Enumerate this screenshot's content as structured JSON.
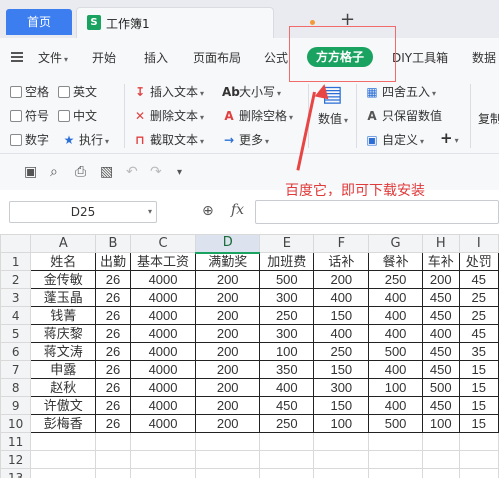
{
  "tabs": {
    "home": "首页",
    "doc_icon_letter": "S",
    "doc_title": "工作簿1",
    "doc_dot": "•",
    "new_tab": "+"
  },
  "menu": {
    "items": [
      "文件",
      "开始",
      "插入",
      "页面布局",
      "公式",
      "方方格子",
      "DIY工具箱",
      "数据"
    ],
    "file_caret": "▾",
    "active": "方方格子"
  },
  "ribbon": {
    "group1": [
      "空格",
      "英文",
      "符号",
      "中文",
      "数字"
    ],
    "execute": "执行",
    "group2": [
      "插入文本",
      "删除文本",
      "截取文本"
    ],
    "group3": [
      "大小写",
      "删除空格",
      "更多"
    ],
    "numeric": "数值",
    "group4": [
      "四舍五入",
      "只保留数值",
      "自定义"
    ],
    "plus": "+",
    "copy": "复制"
  },
  "annotation_text": "百度它，即可下载安装",
  "formula_bar": {
    "cell_ref": "D25",
    "fx": "fx",
    "value": ""
  },
  "sheet": {
    "columns": [
      "A",
      "B",
      "C",
      "D",
      "E",
      "F",
      "G",
      "H",
      "I"
    ],
    "active_column": "D",
    "row_numbers": [
      "1",
      "2",
      "3",
      "4",
      "5",
      "6",
      "7",
      "8",
      "9",
      "10",
      "11",
      "12",
      "13"
    ],
    "rows": [
      [
        "姓名",
        "出勤",
        "基本工资",
        "满勤奖",
        "加班费",
        "话补",
        "餐补",
        "车补",
        "处罚"
      ],
      [
        "金传敏",
        "26",
        "4000",
        "200",
        "500",
        "200",
        "250",
        "200",
        "45"
      ],
      [
        "蓬玉晶",
        "26",
        "4000",
        "200",
        "300",
        "400",
        "400",
        "450",
        "25"
      ],
      [
        "钱菁",
        "26",
        "4000",
        "200",
        "250",
        "150",
        "400",
        "450",
        "25"
      ],
      [
        "蒋庆黎",
        "26",
        "4000",
        "200",
        "300",
        "400",
        "400",
        "400",
        "45"
      ],
      [
        "蒋文涛",
        "26",
        "4000",
        "200",
        "100",
        "250",
        "500",
        "450",
        "35"
      ],
      [
        "申露",
        "26",
        "4000",
        "200",
        "350",
        "150",
        "400",
        "450",
        "15"
      ],
      [
        "赵秋",
        "26",
        "4000",
        "200",
        "400",
        "300",
        "100",
        "500",
        "15"
      ],
      [
        "许傲文",
        "26",
        "4000",
        "200",
        "450",
        "150",
        "400",
        "450",
        "15"
      ],
      [
        "彭梅香",
        "26",
        "4000",
        "200",
        "250",
        "100",
        "500",
        "100",
        "15"
      ]
    ]
  },
  "colors": {
    "accent": "#1aa260",
    "home_tab": "#3c7df0",
    "annotation": "#e03a3a"
  }
}
